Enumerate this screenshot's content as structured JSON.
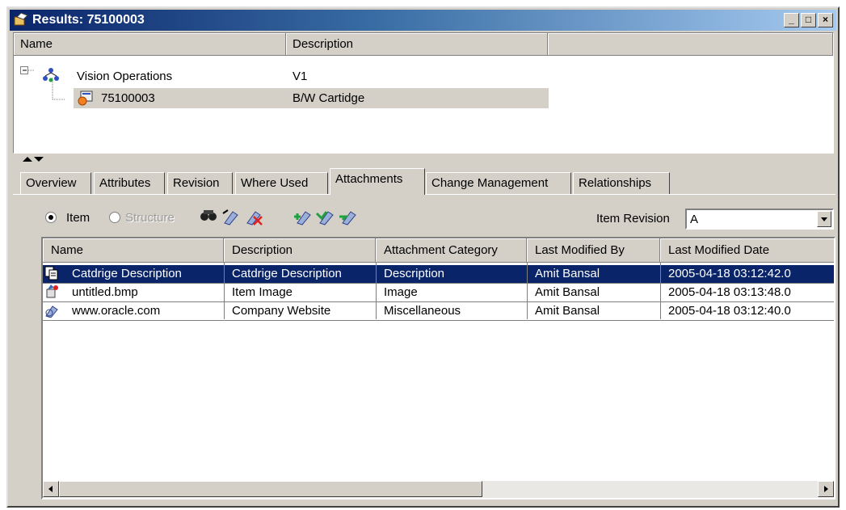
{
  "window": {
    "title": "Results: 75100003",
    "min": "_",
    "max": "□",
    "close": "×"
  },
  "tree": {
    "headers": [
      "Name",
      "Description"
    ],
    "rows": [
      {
        "name": "Vision Operations",
        "description": "V1"
      },
      {
        "name": "75100003",
        "description": "B/W Cartidge"
      }
    ]
  },
  "tabs": [
    "Overview",
    "Attributes",
    "Revision",
    "Where Used",
    "Attachments",
    "Change Management",
    "Relationships"
  ],
  "active_tab": "Attachments",
  "toolbar": {
    "item_label": "Item",
    "structure_label": "Structure",
    "revision_label": "Item Revision",
    "revision_value": "A"
  },
  "grid": {
    "headers": [
      "Name",
      "Description",
      "Attachment Category",
      "Last Modified By",
      "Last Modified Date"
    ],
    "rows": [
      {
        "name": "Catdrige Description",
        "description": "Catdrige Description",
        "category": "Description",
        "modified_by": "Amit Bansal",
        "modified_date": "2005-04-18 03:12:42.0",
        "icon": "document-icon"
      },
      {
        "name": "untitled.bmp",
        "description": "Item Image",
        "category": "Image",
        "modified_by": "Amit Bansal",
        "modified_date": "2005-04-18 03:13:48.0",
        "icon": "image-icon"
      },
      {
        "name": "www.oracle.com",
        "description": "Company Website",
        "category": "Miscellaneous",
        "modified_by": "Amit Bansal",
        "modified_date": "2005-04-18 03:12:40.0",
        "icon": "url-icon"
      }
    ]
  },
  "colors": {
    "selection": "#0a246a",
    "chrome": "#d4d0c8"
  }
}
